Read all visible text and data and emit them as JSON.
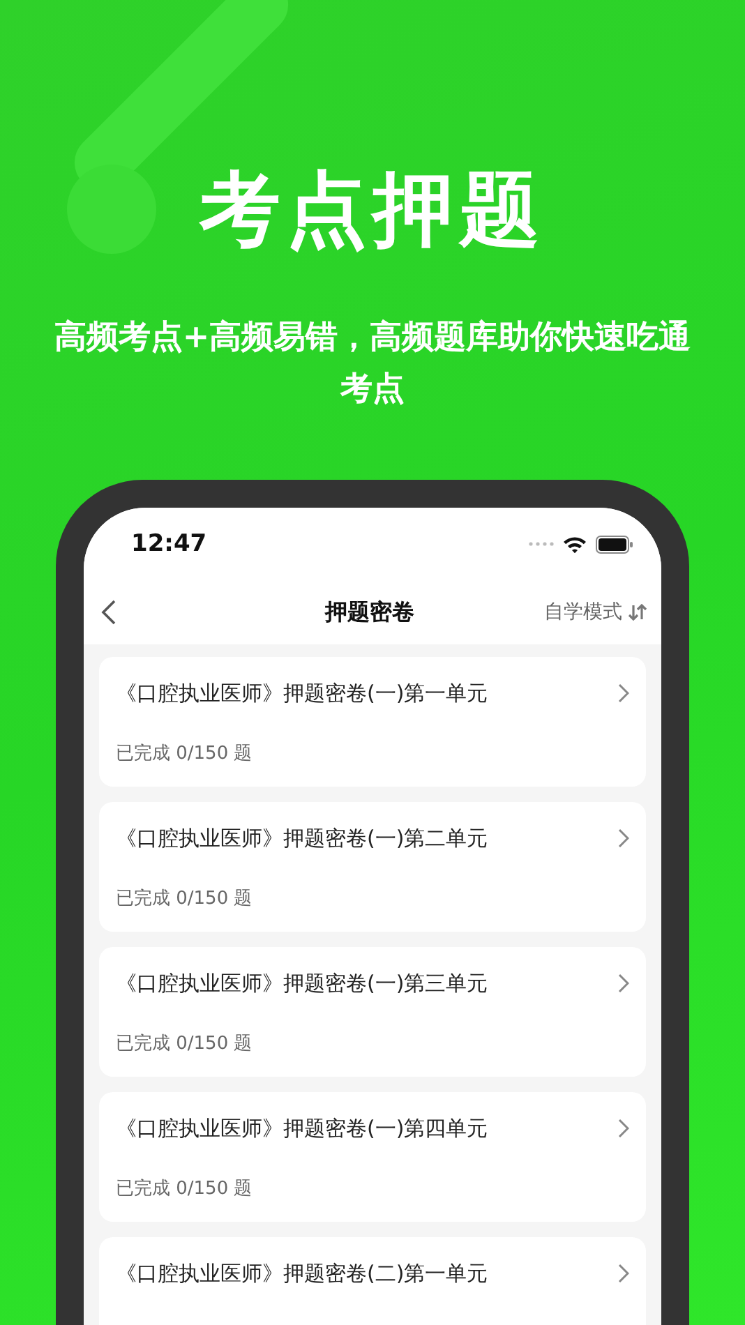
{
  "headline": "考点押题",
  "subtitle": "高频考点+高频易错，高频题库助你快速吃通考点",
  "phone": {
    "time": "12:47",
    "nav": {
      "title": "押题密卷",
      "mode": "自学模式"
    },
    "papers": [
      {
        "title": "《口腔执业医师》押题密卷(一)第一单元",
        "progress": "已完成 0/150 题"
      },
      {
        "title": "《口腔执业医师》押题密卷(一)第二单元",
        "progress": "已完成 0/150 题"
      },
      {
        "title": "《口腔执业医师》押题密卷(一)第三单元",
        "progress": "已完成 0/150 题"
      },
      {
        "title": "《口腔执业医师》押题密卷(一)第四单元",
        "progress": "已完成 0/150 题"
      },
      {
        "title": "《口腔执业医师》押题密卷(二)第一单元"
      }
    ]
  }
}
